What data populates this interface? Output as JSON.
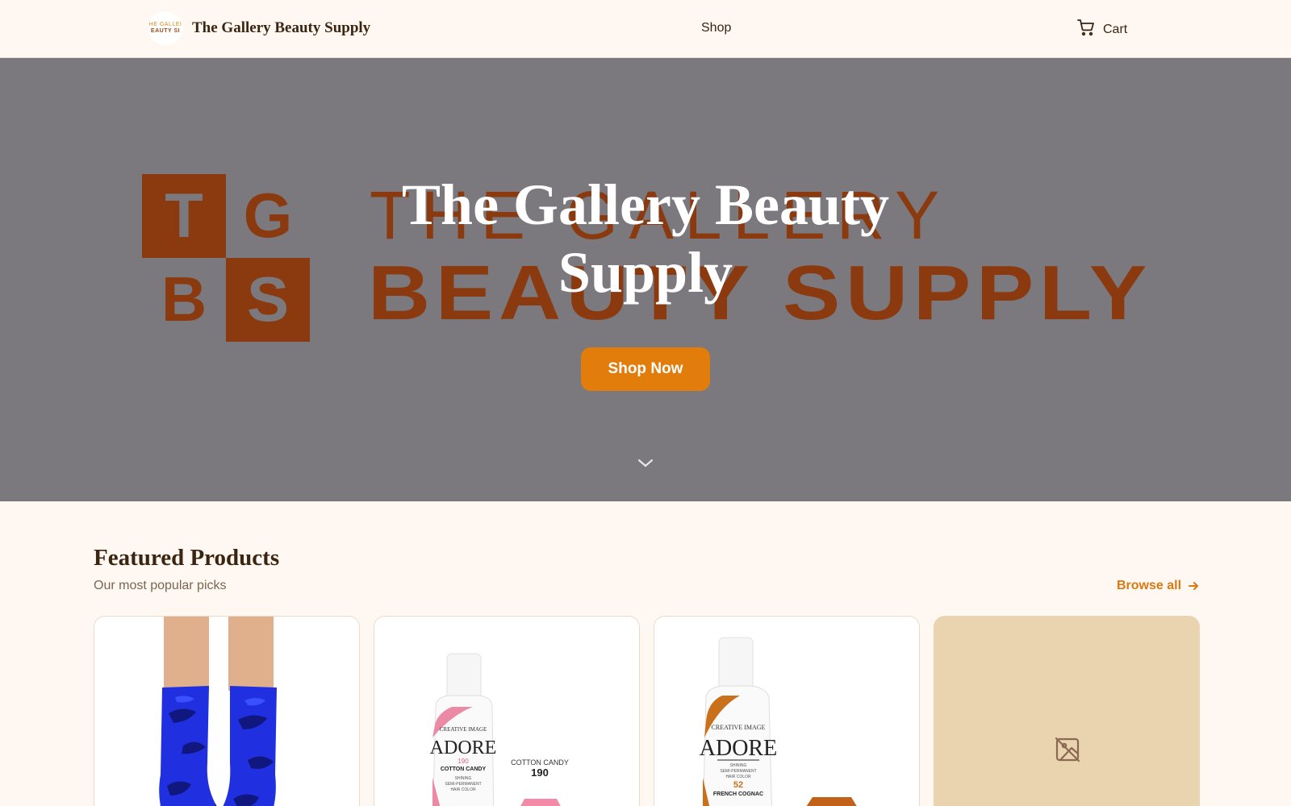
{
  "header": {
    "brand_name": "The Gallery Beauty Supply",
    "logo_text": [
      "HE GALLEI",
      "EAUTY SI"
    ],
    "nav_shop": "Shop",
    "cart_label": "Cart"
  },
  "hero": {
    "background_logo": {
      "monogram": [
        "T",
        "G",
        "B",
        "S"
      ],
      "line1": "THE GALLERY",
      "line2": "BEAUTY SUPPLY"
    },
    "title": "The Gallery Beauty Supply",
    "cta_label": "Shop Now"
  },
  "featured": {
    "title": "Featured Products",
    "subtitle": "Our most popular picks",
    "browse_label": "Browse all",
    "products": [
      {
        "image": "blue-camo-socks"
      },
      {
        "image": "adore-hair-color-cotton-candy",
        "bottle_brand": "ADORE",
        "bottle_maker": "CREATIVE IMAGE",
        "bottle_shade_number": "190",
        "bottle_shade_name": "COTTON CANDY",
        "bottle_desc": [
          "SHINING",
          "SEMI-PERMANENT",
          "HAIR COLOR"
        ],
        "swatch_name": "COTTON CANDY",
        "swatch_number": "190"
      },
      {
        "image": "adore-hair-color-french-cognac",
        "bottle_brand": "ADORE",
        "bottle_maker": "CREATIVE IMAGE",
        "bottle_shade_number": "52",
        "bottle_shade_name": "FRENCH COGNAC",
        "bottle_desc": [
          "SHINING",
          "SEMI-PERMANENT",
          "HAIR COLOR"
        ]
      },
      {
        "image": "image-placeholder"
      }
    ]
  },
  "colors": {
    "background": "#fff8f2",
    "hero_overlay": "#7b797d",
    "accent": "#e27d0c",
    "logo_brown": "#8a3a0e",
    "text_dark": "#3b2410",
    "placeholder_bg": "#ead4b0"
  }
}
